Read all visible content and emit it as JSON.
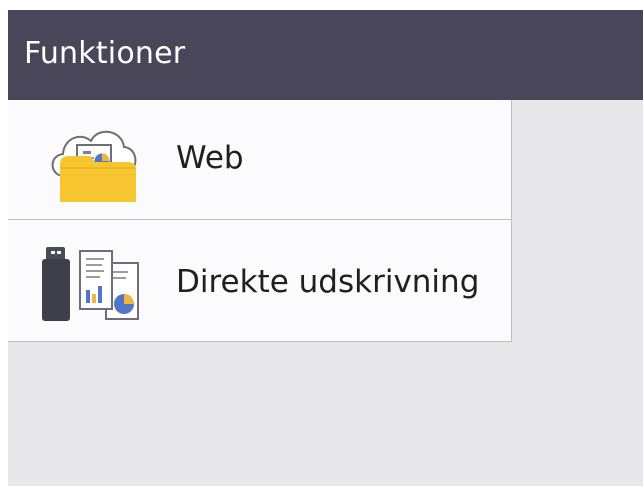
{
  "header": {
    "title": "Funktioner"
  },
  "menu": {
    "items": [
      {
        "label": "Web",
        "icon": "cloud-folder-icon"
      },
      {
        "label": "Direkte udskrivning",
        "icon": "usb-document-icon"
      }
    ]
  },
  "colors": {
    "header_bg": "#4a4659",
    "header_text": "#ffffff",
    "menu_bg": "#fbfafc",
    "screen_bg": "#e8e8ea",
    "divider": "#bdbdc2",
    "folder_yellow": "#f6c52f",
    "usb_dark": "#3f3f49"
  }
}
